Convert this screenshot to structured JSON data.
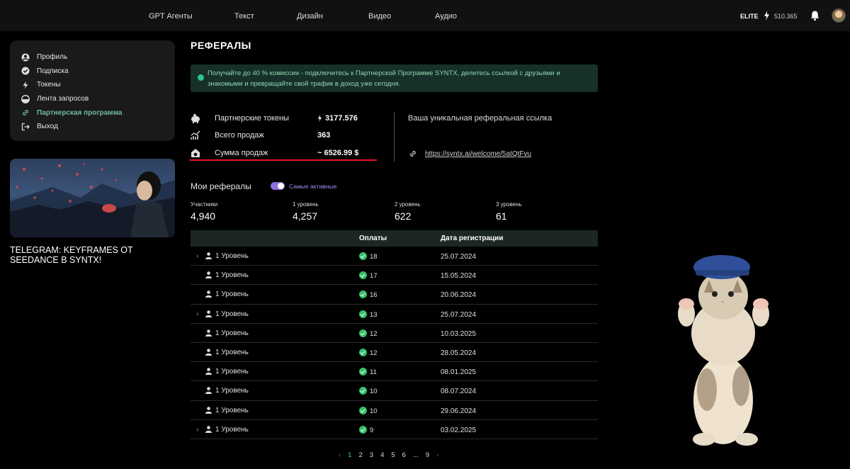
{
  "nav": {
    "items": [
      "GPT Агенты",
      "Текст",
      "Дизайн",
      "Видео",
      "Аудио"
    ],
    "plan": "ELITE",
    "tokens": "510.365"
  },
  "sidebar": {
    "items": [
      {
        "label": "Профиль",
        "icon": "user-icon"
      },
      {
        "label": "Подписка",
        "icon": "check-circle-icon"
      },
      {
        "label": "Токены",
        "icon": "bolt-icon"
      },
      {
        "label": "Лента запросов",
        "icon": "feed-icon"
      },
      {
        "label": "Партнерская программа",
        "icon": "link-icon",
        "active": true
      },
      {
        "label": "Выход",
        "icon": "logout-icon"
      }
    ],
    "promo_title": "TELEGRAM: KEYFRAMES ОТ SEEDANCE В SYNTX!"
  },
  "page": {
    "title": "РЕФЕРАЛЫ",
    "notice": "Получайте до 40 % комиссии - подключитесь к Партнерской Программе SYNTX, делитесь ссылкой с друзьями и знакомыми и превращайте свой трафик в доход уже сегодня."
  },
  "stats": [
    {
      "label": "Партнерские токены",
      "value": "3177.576",
      "icon": "piggy-bank-icon"
    },
    {
      "label": "Всего продаж",
      "value": "363",
      "icon": "chart-up-icon"
    },
    {
      "label": "Сумма продаж",
      "value": "~ 6526.99 $",
      "icon": "money-house-icon"
    }
  ],
  "referral": {
    "label": "Ваша уникальная реферальная ссылка",
    "link": "https://syntx.ai/welcome/5atQtFvu"
  },
  "my_referrals": {
    "title": "Мои рефералы",
    "toggle_label": "Самые активные",
    "metrics": [
      {
        "label": "Участники",
        "value": "4,940"
      },
      {
        "label": "1 уровень",
        "value": "4,257"
      },
      {
        "label": "2 уровень",
        "value": "622"
      },
      {
        "label": "3 уровень",
        "value": "61"
      }
    ]
  },
  "table": {
    "headers": {
      "payments": "Оплаты",
      "date": "Дата регистрации"
    },
    "rows": [
      {
        "level": "1 Уровень",
        "payments": "18",
        "date": "25.07.2024",
        "expandable": true
      },
      {
        "level": "1 Уровень",
        "payments": "17",
        "date": "15.05.2024",
        "expandable": false
      },
      {
        "level": "1 Уровень",
        "payments": "16",
        "date": "20.06.2024",
        "expandable": false
      },
      {
        "level": "1 Уровень",
        "payments": "13",
        "date": "25.07.2024",
        "expandable": true
      },
      {
        "level": "1 Уровень",
        "payments": "12",
        "date": "10.03.2025",
        "expandable": false
      },
      {
        "level": "1 Уровень",
        "payments": "12",
        "date": "28.05.2024",
        "expandable": false
      },
      {
        "level": "1 Уровень",
        "payments": "11",
        "date": "08.01.2025",
        "expandable": false
      },
      {
        "level": "1 Уровень",
        "payments": "10",
        "date": "08.07.2024",
        "expandable": false
      },
      {
        "level": "1 Уровень",
        "payments": "10",
        "date": "29.06.2024",
        "expandable": false
      },
      {
        "level": "1 Уровень",
        "payments": "9",
        "date": "03.02.2025",
        "expandable": true
      }
    ]
  },
  "pagination": {
    "pages": [
      "1",
      "2",
      "3",
      "4",
      "5",
      "6",
      "...",
      "9"
    ],
    "current": "1"
  },
  "colors": {
    "accent": "#4fc6a0",
    "notice_bg": "#17302a",
    "underline": "#e8122a",
    "toggle": "#8c6fe0"
  }
}
